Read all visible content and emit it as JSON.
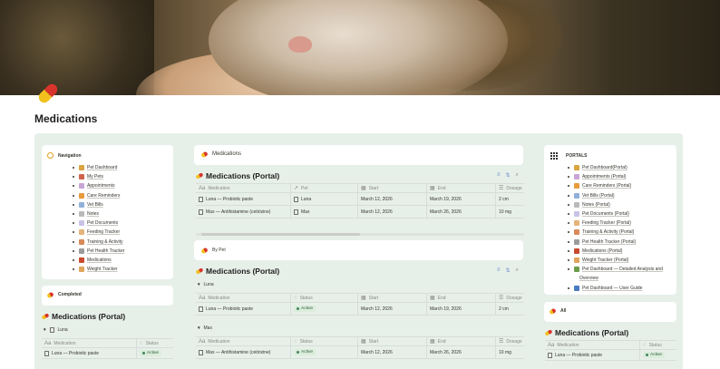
{
  "page": {
    "title": "Medications"
  },
  "nav": {
    "title": "Navigation",
    "items": [
      {
        "label": "Pet Dashboard",
        "color": "#d9a441"
      },
      {
        "label": "My Pets",
        "color": "#d0644d"
      },
      {
        "label": "Appointments",
        "color": "#c9a5d6"
      },
      {
        "label": "Care Reminders",
        "color": "#e89b3c"
      },
      {
        "label": "Vet Bills",
        "color": "#8fb0d9"
      },
      {
        "label": "Notes",
        "color": "#b9b9b9"
      },
      {
        "label": "Pet Documents",
        "color": "#c9c2e8"
      },
      {
        "label": "Feeding Tracker",
        "color": "#e4b47a"
      },
      {
        "label": "Training & Activity",
        "color": "#d88a5a"
      },
      {
        "label": "Pet Health Tracker",
        "color": "#9c9c9c"
      },
      {
        "label": "Medications",
        "color": "#c84a2e"
      },
      {
        "label": "Weight Tracker",
        "color": "#e0a45c"
      }
    ]
  },
  "completed": {
    "title": "Completed"
  },
  "left_db": {
    "title": "Medications (Portal)",
    "group": "Luna",
    "columns": [
      "Medication",
      "Status"
    ],
    "rows": [
      {
        "medication": "Luna — Probiotic paste",
        "status": "Active"
      }
    ]
  },
  "center": {
    "header": "Medications",
    "main_db": {
      "title": "Medications (Portal)",
      "columns": [
        "Medication",
        "Pet",
        "Start",
        "End",
        "Dosage"
      ],
      "rows": [
        {
          "medication": "Luna — Probiotic paste",
          "pet": "Luna",
          "start": "March 12, 2026",
          "end": "March 19, 2026",
          "dosage": "2 cm"
        },
        {
          "medication": "Max — Antihistamine (cetirizine)",
          "pet": "Max",
          "start": "March 12, 2026",
          "end": "March 26, 2026",
          "dosage": "10 mg"
        }
      ]
    },
    "by_pet": "By Pet",
    "grouped_db": {
      "title": "Medications (Portal)",
      "columns": [
        "Medication",
        "Status",
        "Start",
        "End",
        "Dosage"
      ],
      "groups": [
        {
          "name": "Luna",
          "rows": [
            {
              "medication": "Luna — Probiotic paste",
              "status": "Active",
              "start": "March 12, 2026",
              "end": "March 19, 2026",
              "dosage": "2 cm"
            }
          ]
        },
        {
          "name": "Max",
          "rows": [
            {
              "medication": "Max — Antihistamine (cetirizine)",
              "status": "Active",
              "start": "March 12, 2026",
              "end": "March 26, 2026",
              "dosage": "10 mg"
            }
          ]
        }
      ]
    }
  },
  "portals": {
    "title": "PORTALS",
    "items": [
      {
        "label": "Pet Dashboard(Portal)",
        "color": "#d9a441"
      },
      {
        "label": "Appointments (Portal)",
        "color": "#c9a5d6"
      },
      {
        "label": "Care Reminders (Portal)",
        "color": "#e89b3c"
      },
      {
        "label": "Vet Bills (Portal)",
        "color": "#8fb0d9"
      },
      {
        "label": "Notes (Portal)",
        "color": "#b9b9b9"
      },
      {
        "label": "Pet Documents (Portal)",
        "color": "#c9c2e8"
      },
      {
        "label": "Feeding Tracker (Portal)",
        "color": "#e4b47a"
      },
      {
        "label": "Training & Activity (Portal)",
        "color": "#d88a5a"
      },
      {
        "label": "Pet Health Tracker (Portal)",
        "color": "#9c9c9c"
      },
      {
        "label": "Medications (Portal)",
        "color": "#c84a2e"
      },
      {
        "label": "Weight Tracker (Portal)",
        "color": "#e0a45c"
      },
      {
        "label": "Pet Dashboard — Detailed Analysis and",
        "label2": "Overview",
        "color": "#6d9c4a"
      },
      {
        "label": "Pet Dashboard — User Guide",
        "color": "#4a7cc0"
      }
    ]
  },
  "all": {
    "title": "All"
  },
  "right_db": {
    "title": "Medications (Portal)",
    "columns": [
      "Medication",
      "Status"
    ],
    "rows": [
      {
        "medication": "Luna — Probiotic paste",
        "status": "Active"
      }
    ]
  }
}
